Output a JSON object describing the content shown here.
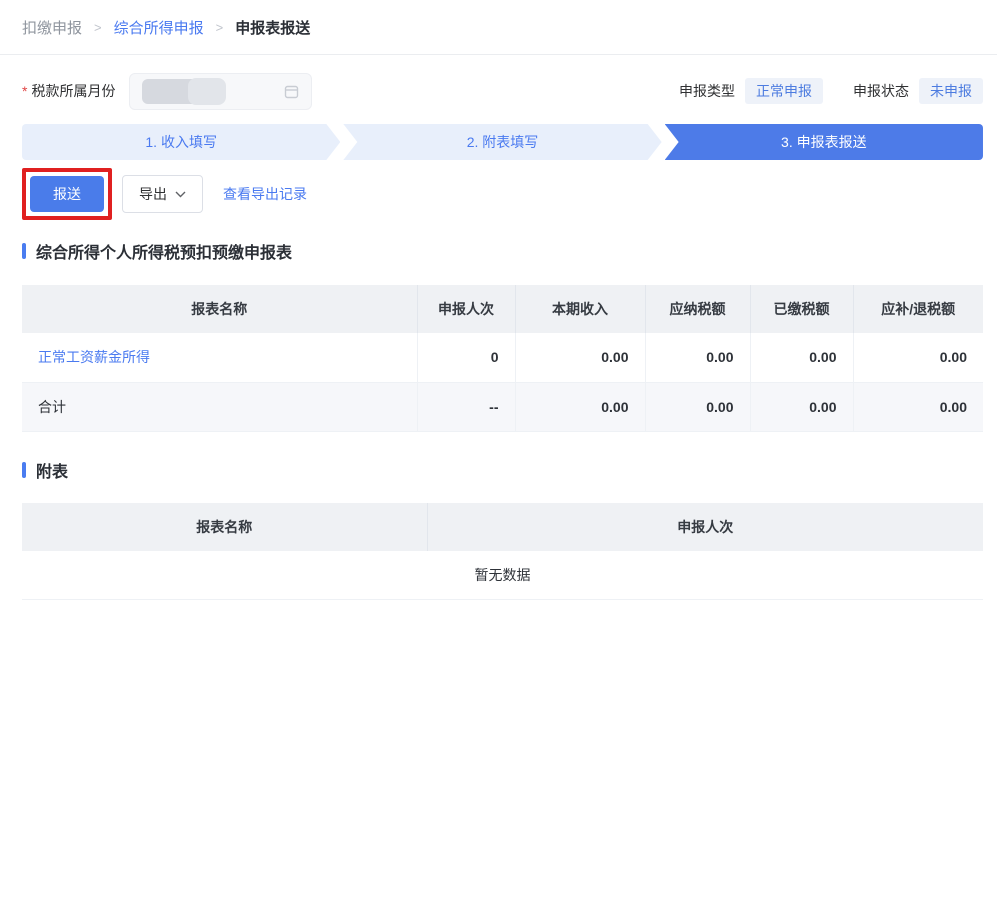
{
  "breadcrumb": {
    "separator": ">",
    "items": [
      {
        "label": "扣缴申报"
      },
      {
        "label": "综合所得申报"
      },
      {
        "label": "申报表报送"
      }
    ]
  },
  "filter": {
    "required_mark": "*",
    "month_label": "税款所属月份",
    "month_value_redacted": true,
    "declare_type_label": "申报类型",
    "declare_type_value": "正常申报",
    "declare_status_label": "申报状态",
    "declare_status_value": "未申报"
  },
  "steps": [
    {
      "label": "1. 收入填写",
      "active": false
    },
    {
      "label": "2. 附表填写",
      "active": false
    },
    {
      "label": "3. 申报表报送",
      "active": true
    }
  ],
  "toolbar": {
    "submit_label": "报送",
    "export_label": "导出",
    "view_export_records_label": "查看导出记录"
  },
  "main_section": {
    "title": "综合所得个人所得税预扣预缴申报表",
    "table": {
      "headers": [
        "报表名称",
        "申报人次",
        "本期收入",
        "应纳税额",
        "已缴税额",
        "应补/退税额"
      ],
      "rows": [
        {
          "name": "正常工资薪金所得",
          "declare_count": "0",
          "current_income": "0.00",
          "tax_payable": "0.00",
          "tax_paid": "0.00",
          "tax_due_refund": "0.00"
        },
        {
          "name": "合计",
          "declare_count": "--",
          "current_income": "0.00",
          "tax_payable": "0.00",
          "tax_paid": "0.00",
          "tax_due_refund": "0.00"
        }
      ]
    }
  },
  "appendix_section": {
    "title": "附表",
    "table": {
      "headers": [
        "报表名称",
        "申报人次"
      ],
      "empty_text": "暂无数据"
    }
  },
  "colors": {
    "accent_blue": "#4a7cf0",
    "link_blue": "#4a7af0",
    "step_inactive_bg": "#e8effb",
    "step_active_bg": "#4d7be8",
    "badge_bg": "#eef2f9",
    "badge_text": "#4d7ce0",
    "table_header_bg": "#eff1f4",
    "annotation_red": "#e02020"
  }
}
